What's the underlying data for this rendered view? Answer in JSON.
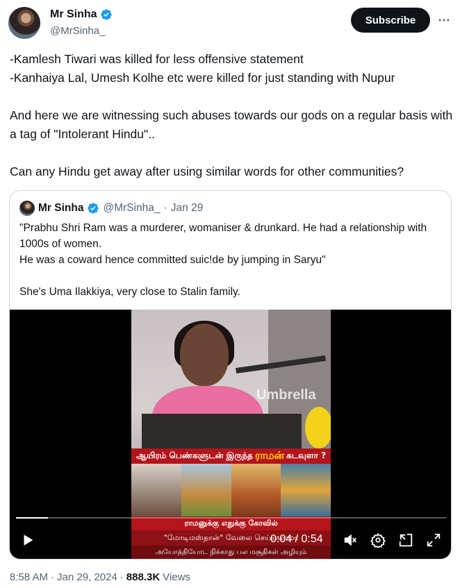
{
  "author": {
    "display_name": "Mr Sinha",
    "handle": "@MrSinha_",
    "verified": true
  },
  "actions": {
    "subscribe_label": "Subscribe",
    "more_icon": "more-horizontal-icon"
  },
  "tweet": {
    "lines": [
      "-Kamlesh Tiwari was killed for less offensive statement",
      "-Kanhaiya Lal, Umesh Kolhe etc were killed for just standing with Nupur",
      "And here we are witnessing such abuses towards our gods on a regular basis with a tag of \"Intolerant Hindu\"..",
      "Can any Hindu get away after using similar words for other communities?"
    ]
  },
  "quote": {
    "display_name": "Mr Sinha",
    "handle": "@MrSinha_",
    "separator": "·",
    "date": "Jan 29",
    "lines": [
      "\"Prabhu Shri Ram was a murderer, womaniser & drunkard. He had a relationship with 1000s of women.",
      "He was a coward hence committed suic!de by jumping in Saryu\"",
      "She's Uma Ilakkiya, very close to Stalin family."
    ]
  },
  "video": {
    "overlay_watermark": "Umbrella",
    "banner_top_pre": "ஆயிரம் பெண்களுடன் இருந்த",
    "banner_top_highlight": "ராமன்",
    "banner_top_post": "கடவுளா ?",
    "banner_mid": "ராமனுக்கு எதுக்கு கோவில்",
    "banner_low": "\"மோடிமஸ்தான்\" வேலை செய்யலாமா",
    "banner_bottom": "அயோத்தியோட நிக்காது பல மசூதிகள் அழியும்",
    "time_current": "0:04",
    "time_separator": "/",
    "time_total": "0:54",
    "progress": 0.074
  },
  "footer": {
    "time": "8:58 AM",
    "separator": "·",
    "date": "Jan 29, 2024",
    "views_count": "888.3K",
    "views_label": "Views"
  },
  "colors": {
    "text_primary": "#0f1419",
    "text_secondary": "#536471",
    "verified_blue": "#1d9bf0",
    "border": "#cfd9de"
  }
}
